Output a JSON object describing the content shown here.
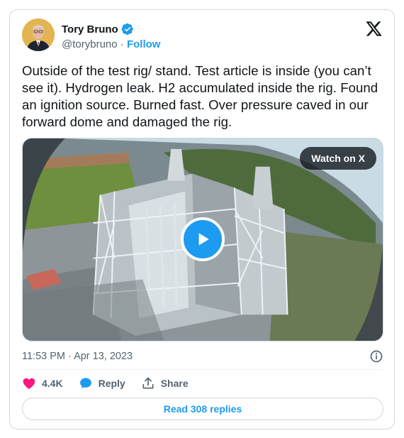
{
  "author": {
    "name": "Tory Bruno",
    "handle": "@torybruno",
    "separator": " · ",
    "follow_label": "Follow"
  },
  "tweet": {
    "text": "Outside of the test rig/ stand. Test article is inside (you can’t see it). Hydrogen leak. H2 accumulated inside the rig. Found an ignition source. Burned fast. Over pressure caved in our forward dome and damaged the rig."
  },
  "media": {
    "watch_label": "Watch on X"
  },
  "meta": {
    "timestamp": "11:53 PM · Apr 13, 2023"
  },
  "actions": {
    "likes": "4.4K",
    "reply_label": "Reply",
    "share_label": "Share"
  },
  "footer": {
    "read_replies_label": "Read 308 replies"
  },
  "icons": {
    "verified": "verified-badge-icon",
    "platform": "x-logo-icon",
    "play": "play-icon",
    "info": "info-icon",
    "like": "heart-icon",
    "reply": "speech-bubble-icon",
    "share": "share-upload-icon"
  },
  "colors": {
    "accent": "#1d9bf0",
    "like": "#f91880",
    "text": "#0f1419",
    "muted": "#536471"
  }
}
